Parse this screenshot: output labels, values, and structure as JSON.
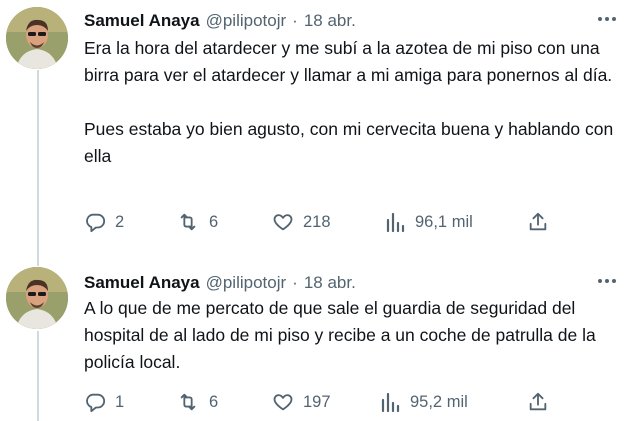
{
  "tweets": [
    {
      "name": "Samuel Anaya",
      "handle": "@pilipotojr",
      "separator": "·",
      "date": "18 abr.",
      "paragraphs": [
        "Era la hora del atardecer y me subí a la azotea de mi piso con una birra para ver el atardecer y llamar a mi amiga para ponernos al día.",
        "Pues estaba yo bien agusto, con mi cervecita buena y hablando con ella"
      ],
      "replies": "2",
      "retweets": "6",
      "likes": "218",
      "views": "96,1 mil"
    },
    {
      "name": "Samuel Anaya",
      "handle": "@pilipotojr",
      "separator": "·",
      "date": "18 abr.",
      "paragraphs": [
        "A lo que de me percato de que sale el guardia de seguridad del hospital de al lado de mi piso y recibe a un coche de patrulla de la policía local."
      ],
      "replies": "1",
      "retweets": "6",
      "likes": "197",
      "views": "95,2 mil"
    }
  ],
  "icons": {
    "more": "more-icon",
    "reply": "reply-icon",
    "retweet": "retweet-icon",
    "like": "heart-icon",
    "views": "views-icon",
    "share": "share-icon"
  },
  "colors": {
    "text": "#0f1419",
    "secondary": "#536471",
    "thread_line": "#cfd9de"
  }
}
